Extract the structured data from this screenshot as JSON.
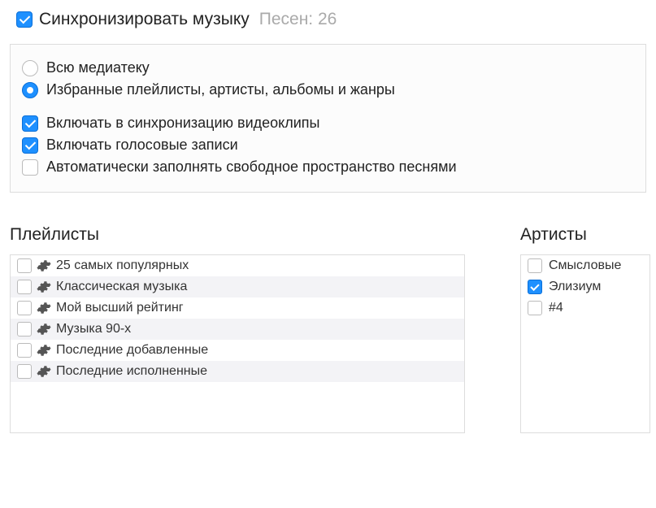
{
  "header": {
    "sync_label": "Синхронизировать музыку",
    "count_label": "Песен: 26"
  },
  "options": {
    "radio_all": "Всю медиатеку",
    "radio_selected": "Избранные плейлисты, артисты, альбомы и жанры",
    "include_videos": "Включать в синхронизацию видеоклипы",
    "include_voice": "Включать голосовые записи",
    "autofill": "Автоматически заполнять свободное пространство песнями"
  },
  "playlists": {
    "title": "Плейлисты",
    "items": [
      "25 самых популярных",
      "Классическая музыка",
      "Мой высший рейтинг",
      "Музыка 90-х",
      "Последние добавленные",
      "Последние исполненные"
    ]
  },
  "artists": {
    "title": "Артисты",
    "items": [
      {
        "label": "Смысловые ",
        "checked": false
      },
      {
        "label": "Элизиум",
        "checked": true
      },
      {
        "label": "#4",
        "checked": false
      }
    ]
  }
}
